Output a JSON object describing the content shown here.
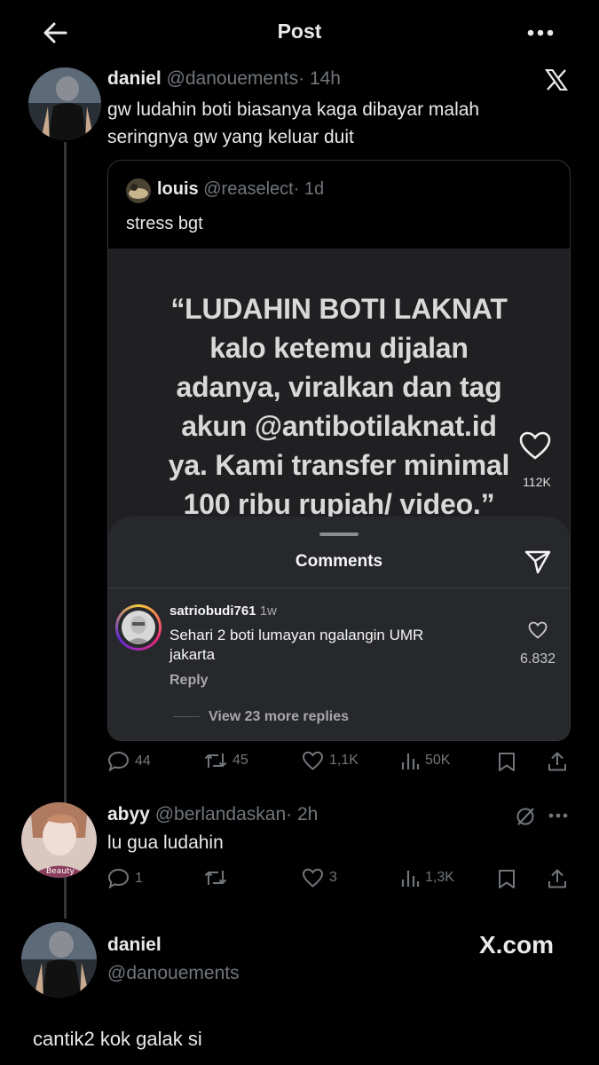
{
  "header": {
    "title": "Post"
  },
  "main_post": {
    "name": "daniel",
    "handle": "@danouements",
    "time": "· 14h",
    "text_line1": "gw ludahin boti biasanya kaga dibayar malah",
    "text_line2": "seringnya gw yang keluar duit",
    "quote": {
      "name": "louis",
      "handle": "@reaselect",
      "time": "· 1d",
      "text": "stress bgt",
      "media": {
        "lines": [
          "“LUDAHIN BOTI LAKNAT",
          "kalo ketemu dijalan",
          "adanya, viralkan dan tag",
          "akun @antibotilaknat.id",
          "ya. Kami transfer minimal",
          "100 ribu rupiah/ video.”"
        ],
        "like_count": "112K",
        "comments_sheet": {
          "title": "Comments",
          "comment_user": "satriobudi761",
          "comment_age": "1w",
          "comment_line1": "Sehari 2 boti lumayan ngalangin UMR",
          "comment_line2": "jakarta",
          "comment_likes": "6.832",
          "reply_label": "Reply",
          "view_more": "View 23 more replies"
        }
      }
    },
    "actions": {
      "replies": "44",
      "reposts": "45",
      "likes": "1,1K",
      "views": "50K"
    }
  },
  "reply_post": {
    "name": "abyy",
    "handle": "@berlandaskan",
    "time": "· 2h",
    "text": "lu gua ludahin",
    "actions": {
      "replies": "1",
      "reposts": "",
      "likes": "3",
      "views": "1,3K"
    }
  },
  "bottom_post": {
    "name": "daniel",
    "handle": "@danouements",
    "watermark": "X.com",
    "text": "cantik2 kok galak si"
  },
  "colors": {
    "background": "#000000",
    "text": "#e7e9ea",
    "muted": "#71767b",
    "divider": "#2f3336"
  }
}
